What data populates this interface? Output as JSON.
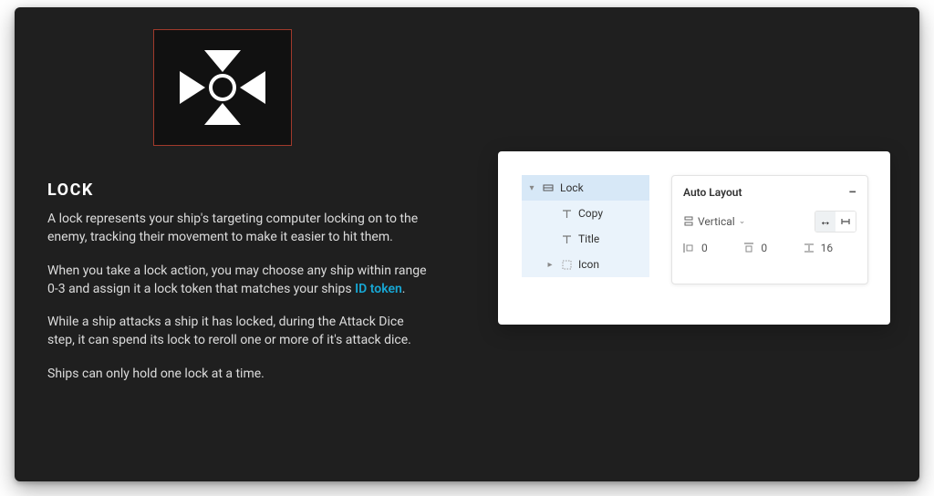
{
  "content": {
    "title": "LOCK",
    "p1": "A lock represents your ship's targeting computer locking on to the enemy, tracking their movement to make it easier to hit them.",
    "p2_a": "When you take a lock action, you may choose any ship within range 0-3 and assign it a lock token that matches your ships ",
    "p2_link": "ID token",
    "p2_b": ".",
    "p3": "While a ship attacks a ship it has locked, during the Attack Dice step, it can spend its lock to reroll one or more of it's attack dice.",
    "p4": "Ships can only hold one lock at a time."
  },
  "ui": {
    "layers": {
      "root": "Lock",
      "children": [
        "Copy",
        "Title",
        "Icon"
      ]
    },
    "inspector": {
      "title": "Auto Layout",
      "direction_label": "Vertical",
      "padding_h": "0",
      "padding_v": "0",
      "spacing": "16"
    }
  },
  "colors": {
    "link": "#17a7d4",
    "frame_border": "#a13a2b"
  }
}
